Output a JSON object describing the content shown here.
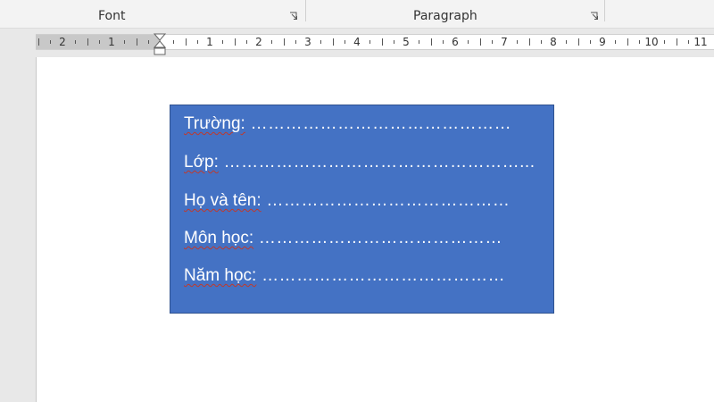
{
  "ribbon": {
    "groups": [
      {
        "label": "Font",
        "launcher_icon": "dialog-launcher-icon"
      },
      {
        "label": "Paragraph",
        "launcher_icon": "dialog-launcher-icon"
      }
    ]
  },
  "ruler": {
    "labels": [
      "2",
      "1",
      "1",
      "2",
      "3",
      "4",
      "5",
      "6",
      "7",
      "8",
      "9",
      "10",
      "11"
    ]
  },
  "textbox": {
    "fill_color": "#4472c4",
    "border_color": "#2f528f",
    "text_color": "#ffffff",
    "lines": [
      {
        "label": "Trường:",
        "dots": " ………………………………………"
      },
      {
        "label": "Lớp:",
        "dots": " ……………………………………………..."
      },
      {
        "label": "Họ và tên:",
        "dots": " ……………………………………"
      },
      {
        "label": "Môn học:",
        "dots": " ……………………………………"
      },
      {
        "label": "Năm học:",
        "dots": " ……………………………………"
      }
    ]
  }
}
